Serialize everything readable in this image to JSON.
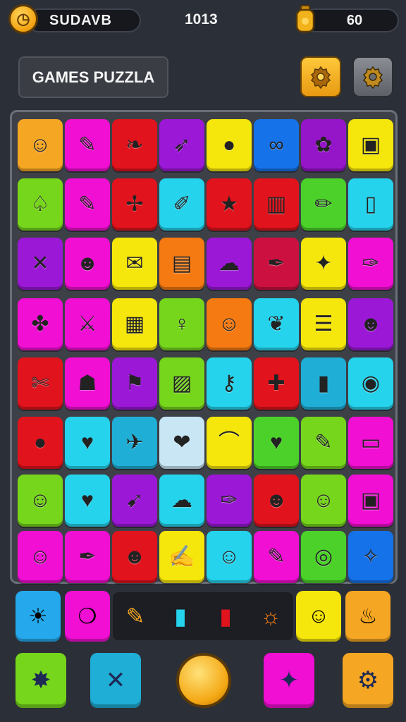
{
  "topbar": {
    "player_name": "SUDAVB",
    "score": "1013",
    "coins": "60",
    "coin_icon": "coin-icon",
    "jar_icon": "jar-icon"
  },
  "header": {
    "title": "GAMES PUZZLA"
  },
  "board": {
    "rows": [
      [
        {
          "c": "#f5a623",
          "i": "face-icon",
          "s": "☺"
        },
        {
          "c": "#f00fd2",
          "i": "crayon-icon",
          "s": "✎"
        },
        {
          "c": "#e1131d",
          "i": "leaf-icon",
          "s": "❧"
        },
        {
          "c": "#9b18d6",
          "i": "rocket-icon",
          "s": "➶"
        },
        {
          "c": "#f5e60b",
          "i": "ball-icon",
          "s": "●"
        },
        {
          "c": "#1672e8",
          "i": "glasses-icon",
          "s": "∞"
        },
        {
          "c": "#9515c9",
          "i": "frog-icon",
          "s": "✿"
        },
        {
          "c": "#f5e60b",
          "i": "radio-icon",
          "s": "▣"
        }
      ],
      [
        {
          "c": "#76d61c",
          "i": "shield-icon",
          "s": "♤"
        },
        {
          "c": "#f00fd2",
          "i": "pencil-icon",
          "s": "✎"
        },
        {
          "c": "#e1131d",
          "i": "wrench-icon",
          "s": "✢"
        },
        {
          "c": "#25d3ec",
          "i": "pen-icon",
          "s": "✐"
        },
        {
          "c": "#e1131d",
          "i": "star-icon",
          "s": "★"
        },
        {
          "c": "#e1131d",
          "i": "cake-icon",
          "s": "▥"
        },
        {
          "c": "#4bd12a",
          "i": "marker-icon",
          "s": "✏"
        },
        {
          "c": "#25d3ec",
          "i": "phone-icon",
          "s": "▯"
        }
      ],
      [
        {
          "c": "#9b18d6",
          "i": "hammer-icon",
          "s": "✕"
        },
        {
          "c": "#f00fd2",
          "i": "cat-icon",
          "s": "☻"
        },
        {
          "c": "#f5e60b",
          "i": "envelope-icon",
          "s": "✉"
        },
        {
          "c": "#f57a12",
          "i": "bag-icon",
          "s": "▤"
        },
        {
          "c": "#9b18d6",
          "i": "sheep-icon",
          "s": "☁"
        },
        {
          "c": "#cc1140",
          "i": "brush-icon",
          "s": "✒"
        },
        {
          "c": "#f5e60b",
          "i": "bird-icon",
          "s": "✦"
        },
        {
          "c": "#f00fd2",
          "i": "syringe-icon",
          "s": "✑"
        }
      ],
      [
        {
          "c": "#f00fd2",
          "i": "plant-icon",
          "s": "✤"
        },
        {
          "c": "#f00fd2",
          "i": "sword-icon",
          "s": "⚔"
        },
        {
          "c": "#f5e60b",
          "i": "calculator-icon",
          "s": "▦"
        },
        {
          "c": "#76d61c",
          "i": "spoon-icon",
          "s": "♀"
        },
        {
          "c": "#f57a12",
          "i": "cat-face-icon",
          "s": "☺"
        },
        {
          "c": "#25d3ec",
          "i": "feather-icon",
          "s": "❦"
        },
        {
          "c": "#f5e60b",
          "i": "register-icon",
          "s": "☰"
        },
        {
          "c": "#9b18d6",
          "i": "alien-icon",
          "s": "☻"
        }
      ],
      [
        {
          "c": "#e1131d",
          "i": "scissors-icon",
          "s": "✄"
        },
        {
          "c": "#f00fd2",
          "i": "ghost-icon",
          "s": "☗"
        },
        {
          "c": "#9b18d6",
          "i": "flag-icon",
          "s": "⚑"
        },
        {
          "c": "#76d61c",
          "i": "frame-icon",
          "s": "▨"
        },
        {
          "c": "#25d3ec",
          "i": "key-icon",
          "s": "⚷"
        },
        {
          "c": "#e1131d",
          "i": "screwdriver-icon",
          "s": "✚"
        },
        {
          "c": "#1faed6",
          "i": "book-icon",
          "s": "▮"
        },
        {
          "c": "#25d3ec",
          "i": "disc-icon",
          "s": "◉"
        }
      ],
      [
        {
          "c": "#e1131d",
          "i": "orange-icon",
          "s": "●"
        },
        {
          "c": "#25d3ec",
          "i": "heart-icon",
          "s": "♥"
        },
        {
          "c": "#1faed6",
          "i": "plane-icon",
          "s": "✈"
        },
        {
          "c": "#c9e6f5",
          "i": "berry-icon",
          "s": "❤"
        },
        {
          "c": "#f5e60b",
          "i": "rainbow-icon",
          "s": "⌒"
        },
        {
          "c": "#4bd12a",
          "i": "apple-icon",
          "s": "♥"
        },
        {
          "c": "#76d61c",
          "i": "crayon-icon",
          "s": "✎"
        },
        {
          "c": "#f00fd2",
          "i": "tablet-icon",
          "s": "▭"
        }
      ],
      [
        {
          "c": "#76d61c",
          "i": "person-icon",
          "s": "☺"
        },
        {
          "c": "#25d3ec",
          "i": "strawberry-icon",
          "s": "♥"
        },
        {
          "c": "#9b18d6",
          "i": "arrow-icon",
          "s": "➹"
        },
        {
          "c": "#25d3ec",
          "i": "cloud-icon",
          "s": "☁"
        },
        {
          "c": "#9b18d6",
          "i": "torch-icon",
          "s": "✑"
        },
        {
          "c": "#e1131d",
          "i": "monster-icon",
          "s": "☻"
        },
        {
          "c": "#76d61c",
          "i": "pear-icon",
          "s": "☺"
        },
        {
          "c": "#f00fd2",
          "i": "screen-icon",
          "s": "▣"
        }
      ],
      [
        {
          "c": "#f00fd2",
          "i": "blob-icon",
          "s": "☺"
        },
        {
          "c": "#f00fd2",
          "i": "quill-icon",
          "s": "✒"
        },
        {
          "c": "#e1131d",
          "i": "tiger-icon",
          "s": "☻"
        },
        {
          "c": "#f5e60b",
          "i": "chick-icon",
          "s": "✍"
        },
        {
          "c": "#25d3ec",
          "i": "drop-icon",
          "s": "☺"
        },
        {
          "c": "#f00fd2",
          "i": "lipstick-icon",
          "s": "✎"
        },
        {
          "c": "#4bd12a",
          "i": "robot-icon",
          "s": "◎"
        },
        {
          "c": "#1672e8",
          "i": "bee-icon",
          "s": "✧"
        }
      ]
    ]
  },
  "tray": {
    "left": [
      {
        "c": "#25a8ec",
        "i": "sun-icon",
        "s": "☀"
      },
      {
        "c": "#f00fd2",
        "i": "bubble-icon",
        "s": "❍"
      }
    ],
    "slots": [
      {
        "i": "crayon-icon",
        "s": "✎",
        "col": "#f5a623"
      },
      {
        "i": "bottle-icon",
        "s": "▮",
        "col": "#25d3ec"
      },
      {
        "i": "bottle-red-icon",
        "s": "▮",
        "col": "#e1131d"
      },
      {
        "i": "magnifier-icon",
        "s": "☼",
        "col": "#f57a12"
      }
    ],
    "right": [
      {
        "c": "#f5e60b",
        "i": "bird-face-icon",
        "s": "☺"
      },
      {
        "c": "#f5a623",
        "i": "balloon-icon",
        "s": "♨"
      }
    ]
  },
  "bottom": {
    "buttons": [
      {
        "c": "#76d61c",
        "i": "spinner-icon",
        "s": "✸"
      },
      {
        "c": "#1faed6",
        "i": "shuffle-icon",
        "s": "✕"
      },
      {
        "c": "#f00fd2",
        "i": "hammer-tool-icon",
        "s": "✦"
      },
      {
        "c": "#f5a623",
        "i": "gear-icon",
        "s": "⚙"
      }
    ]
  }
}
